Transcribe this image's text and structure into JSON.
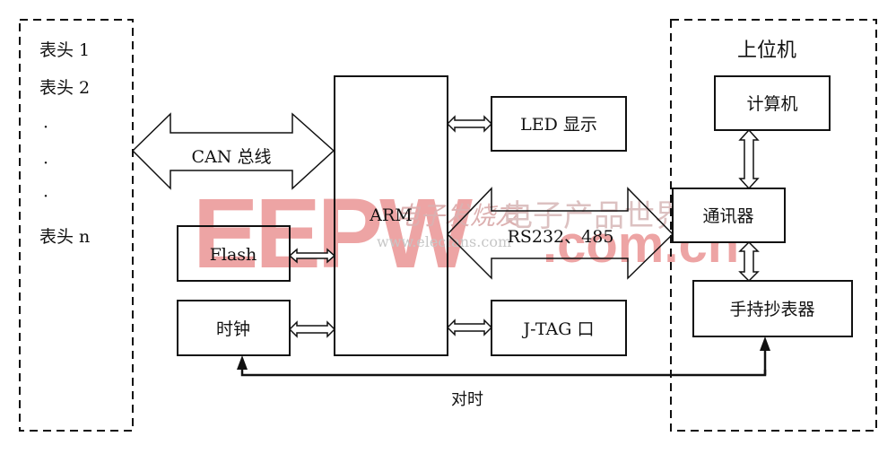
{
  "left_group": {
    "items": [
      "表头 1",
      "表头 2",
      "·",
      "·",
      "·",
      "表头 n"
    ]
  },
  "bus": {
    "can_label": "CAN 总线",
    "serial_label": "RS232、485"
  },
  "blocks": {
    "arm": "ARM",
    "led": "LED 显示",
    "jtag": "J-TAG 口",
    "flash": "Flash",
    "clock": "时钟"
  },
  "host": {
    "title": "上位机",
    "computer": "计算机",
    "communicator": "通讯器",
    "handheld": "手持抄表器"
  },
  "sync_label": "对时",
  "watermark": {
    "logo": "EEPW",
    "text1": "电子发烧友",
    "text2": "www.elecfans.com",
    "text3": "电子产品世界",
    "text4": ".com.cn",
    "color": "#e05a5a"
  }
}
